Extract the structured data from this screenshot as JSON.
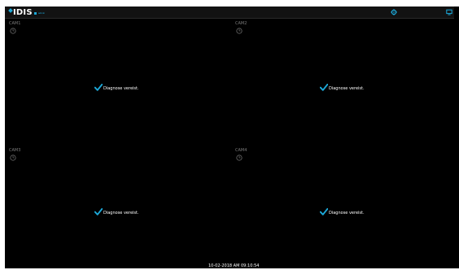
{
  "app": {
    "brand": "IDIS",
    "brand_sub": "admin"
  },
  "topbar": {
    "icons": [
      "gear-icon",
      "monitor-icon"
    ],
    "accent_color": "#1ca8d8"
  },
  "cameras": [
    {
      "label": "CAM1",
      "status": "Diagnose vereist."
    },
    {
      "label": "CAM2",
      "status": "Diagnose vereist."
    },
    {
      "label": "CAM3",
      "status": "Diagnose vereist."
    },
    {
      "label": "CAM4",
      "status": "Diagnose vereist."
    }
  ],
  "status_bar": {
    "datetime": "10-02-2018 AM 09:10:54"
  }
}
